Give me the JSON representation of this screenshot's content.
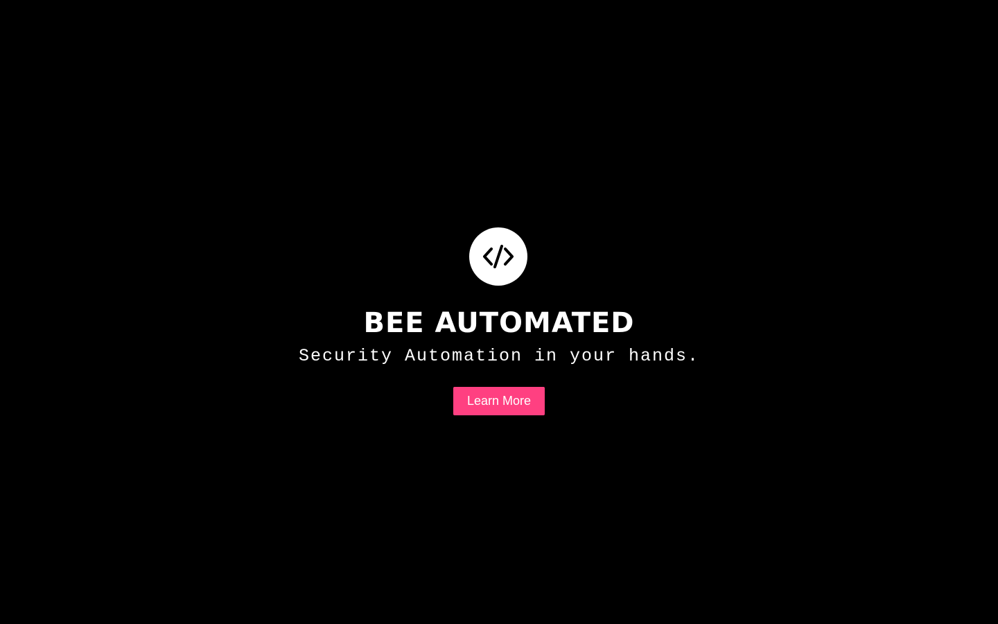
{
  "theme": {
    "background": "#000000",
    "text": "#ffffff",
    "accent": "#ff4081",
    "logo_bg": "#ffffff",
    "logo_fg": "#000000"
  },
  "hero": {
    "logo_icon": "code-icon",
    "title": "BEE AUTOMATED",
    "tagline": "Security Automation in your hands.",
    "cta_label": "Learn More"
  }
}
